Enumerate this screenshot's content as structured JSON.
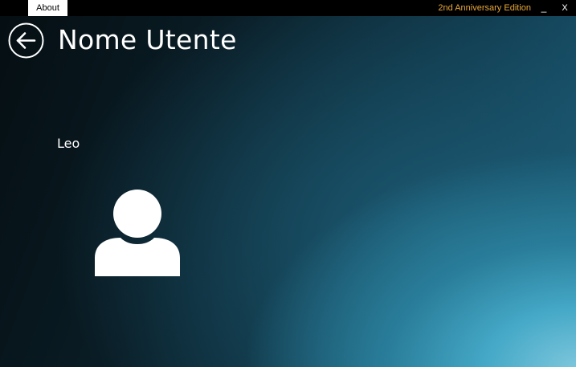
{
  "topbar": {
    "about_label": "About",
    "edition_label": "2nd Anniversary Edition",
    "minimize_label": "_",
    "close_label": "X",
    "edition_color": "#e8a83a"
  },
  "header": {
    "back_icon": "back-arrow-circle-icon",
    "title": "Nome Utente"
  },
  "user": {
    "name": "Leo",
    "avatar_icon": "user-silhouette-icon"
  }
}
